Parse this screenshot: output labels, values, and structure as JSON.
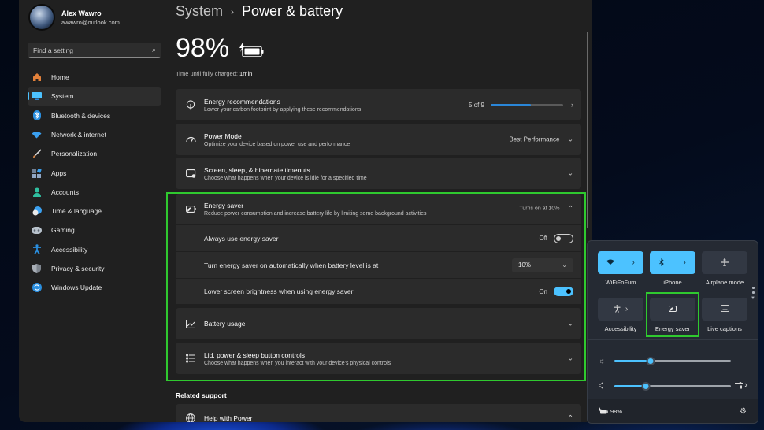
{
  "profile": {
    "name": "Alex Wawro",
    "email": "awawro@outlook.com"
  },
  "search": {
    "placeholder": "Find a setting",
    "icon": "search-icon"
  },
  "sidebar": {
    "items": [
      {
        "label": "Home",
        "icon": "home-icon",
        "color": "#e2803a"
      },
      {
        "label": "System",
        "icon": "system-icon",
        "color": "#4cc2ff",
        "active": true
      },
      {
        "label": "Bluetooth & devices",
        "icon": "bluetooth-icon",
        "color": "#2a8fe0"
      },
      {
        "label": "Network & internet",
        "icon": "wifi-icon",
        "color": "#3aa0f0"
      },
      {
        "label": "Personalization",
        "icon": "brush-icon",
        "color": "#d98a4c"
      },
      {
        "label": "Apps",
        "icon": "apps-icon",
        "color": "#8fa6c4"
      },
      {
        "label": "Accounts",
        "icon": "accounts-icon",
        "color": "#2fbfa0"
      },
      {
        "label": "Time & language",
        "icon": "globe-clock-icon",
        "color": "#3aa0f0"
      },
      {
        "label": "Gaming",
        "icon": "gamepad-icon",
        "color": "#b8c2cc"
      },
      {
        "label": "Accessibility",
        "icon": "accessibility-icon",
        "color": "#2a8fe0"
      },
      {
        "label": "Privacy & security",
        "icon": "shield-icon",
        "color": "#a8aeb6"
      },
      {
        "label": "Windows Update",
        "icon": "update-icon",
        "color": "#2a8fe0"
      }
    ]
  },
  "header": {
    "parent": "System",
    "separator": "›",
    "title": "Power & battery"
  },
  "battery": {
    "percent": "98%",
    "charge_label": "Time until fully charged:",
    "charge_value": "1min",
    "level": 0.98
  },
  "cards": {
    "energy_recs": {
      "title": "Energy recommendations",
      "sub": "Lower your carbon footprint by applying these recommendations",
      "count": "5 of 9",
      "progress": 0.556
    },
    "power_mode": {
      "title": "Power Mode",
      "sub": "Optimize your device based on power use and performance",
      "value": "Best Performance"
    },
    "screen_sleep": {
      "title": "Screen, sleep, & hibernate timeouts",
      "sub": "Choose what happens when your device is idle for a specified time"
    },
    "energy_saver": {
      "title": "Energy saver",
      "sub": "Reduce power consumption and increase battery life by limiting some background activities",
      "status": "Turns on at 10%",
      "always": {
        "label": "Always use energy saver",
        "state": "Off"
      },
      "auto": {
        "label": "Turn energy saver on automatically when battery level is at",
        "value": "10%"
      },
      "brightness": {
        "label": "Lower screen brightness when using energy saver",
        "state": "On"
      }
    },
    "battery_usage": {
      "title": "Battery usage"
    },
    "lid": {
      "title": "Lid, power & sleep button controls",
      "sub": "Choose what happens when you interact with your device's physical controls"
    }
  },
  "related": {
    "heading": "Related support",
    "help_title": "Help with Power"
  },
  "quick_settings": {
    "tiles": [
      {
        "label": "WiFiFoFum",
        "icon": "wifi-icon",
        "active": true,
        "expandable": true
      },
      {
        "label": "iPhone",
        "icon": "bluetooth-icon",
        "active": true,
        "expandable": true
      },
      {
        "label": "Airplane mode",
        "icon": "airplane-icon",
        "active": false
      },
      {
        "label": "Accessibility",
        "icon": "accessibility-icon",
        "active": false,
        "expandable": true
      },
      {
        "label": "Energy saver",
        "icon": "energy-saver-icon",
        "active": false
      },
      {
        "label": "Live captions",
        "icon": "captions-icon",
        "active": false
      }
    ],
    "brightness": 0.31,
    "volume": 0.27,
    "battery_text": "98%"
  },
  "colors": {
    "accent": "#4cc2ff",
    "highlight": "#2fc92f",
    "progress": "#2a86d8"
  }
}
